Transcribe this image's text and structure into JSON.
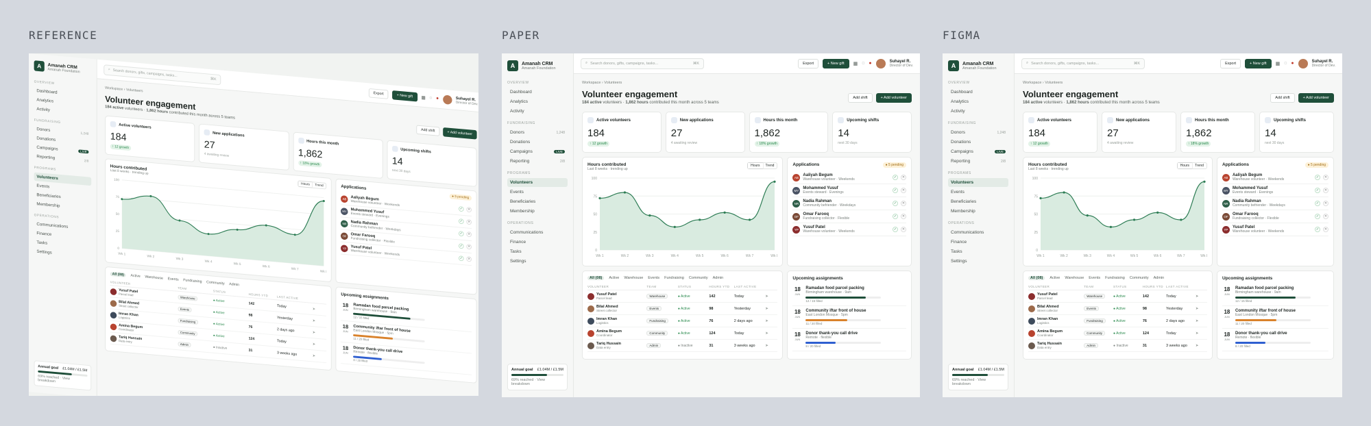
{
  "labels": {
    "reference": "REFERENCE",
    "paper": "PAPER",
    "figma": "FIGMA"
  },
  "org": {
    "name": "Amanah CRM",
    "sub": "Amanah Foundation",
    "mark": "A"
  },
  "nav": {
    "overview_label": "OVERVIEW",
    "overview": [
      "Dashboard",
      "Analytics",
      "Activity"
    ],
    "fundraising_label": "FUNDRAISING",
    "fundraising": [
      {
        "label": "Donors",
        "badge": "1,248"
      },
      {
        "label": "Donations",
        "badge": ""
      },
      {
        "label": "Campaigns",
        "badge": "LIVE"
      },
      {
        "label": "Reporting",
        "badge": "2/8"
      }
    ],
    "programs_label": "PROGRAMS",
    "programs": [
      "Volunteers",
      "Events",
      "Beneficiaries",
      "Membership"
    ],
    "operations_label": "OPERATIONS",
    "operations": [
      "Communications",
      "Finance",
      "Tasks",
      "Settings"
    ]
  },
  "goal": {
    "label": "Annual goal",
    "value": "£1.04M / £1.5M",
    "note": "69% reached · View breakdown",
    "progress": 0.69
  },
  "search": {
    "placeholder": "Search donors, gifts, campaigns, tasks...",
    "kbd": "⌘K"
  },
  "top": {
    "export": "Export",
    "new_gift": "+ New gift",
    "user": "Suhayel R.",
    "role": "Director of Dev."
  },
  "page": {
    "crumb": "Workspace  ›  Volunteers",
    "title": "Volunteer engagement",
    "sub_strong1": "184 active",
    "sub1": " volunteers · ",
    "sub_strong2": "1,862 hours",
    "sub2": " contributed this month across 5 teams",
    "add_shift": "Add shift",
    "add_volunteer": "+ Add volunteer"
  },
  "kpis": [
    {
      "label": "Active volunteers",
      "value": "184",
      "note": "↑ 12 growth",
      "growth": true
    },
    {
      "label": "New applications",
      "value": "27",
      "note": "4 awaiting review",
      "growth": false
    },
    {
      "label": "Hours this month",
      "value": "1,862",
      "note": "↑ 18% growth",
      "growth": true
    },
    {
      "label": "Upcoming shifts",
      "value": "14",
      "note": "next 30 days",
      "growth": false
    }
  ],
  "chart_title": "Hours contributed",
  "chart_sub": "Last 8 weeks · trending up",
  "seg": [
    "Hours",
    "Trend"
  ],
  "chart_data": {
    "type": "area",
    "x": [
      "Wk 1",
      "Wk 2",
      "Wk 3",
      "Wk 4",
      "Wk 5",
      "Wk 6",
      "Wk 7",
      "Wk 8"
    ],
    "values": [
      72,
      80,
      48,
      32,
      42,
      52,
      42,
      95
    ],
    "yticks": [
      0,
      25,
      50,
      75,
      100
    ],
    "ylim": [
      0,
      100
    ]
  },
  "applications": {
    "title": "Applications",
    "pending": "● 5 pending",
    "items": [
      {
        "initials": "AB",
        "name": "Aaliyah Begum",
        "desc": "Warehouse volunteer · Weekends",
        "color": "#b8432f"
      },
      {
        "initials": "MY",
        "name": "Mohammed Yusuf",
        "desc": "Events steward · Evenings",
        "color": "#4a5364"
      },
      {
        "initials": "NR",
        "name": "Nadia Rahman",
        "desc": "Community befriender · Weekdays",
        "color": "#2e5e48"
      },
      {
        "initials": "OF",
        "name": "Omar Farooq",
        "desc": "Fundraising collector · Flexible",
        "color": "#7a4a36"
      },
      {
        "initials": "YP",
        "name": "Yusuf Patel",
        "desc": "Warehouse volunteer · Weekends",
        "color": "#8b2d2d"
      }
    ]
  },
  "filters": [
    "All (08)",
    "Active",
    "Warehouse",
    "Events",
    "Fundraising",
    "Community",
    "Admin"
  ],
  "table_head": [
    "VOLUNTEER",
    "TEAM",
    "STATUS",
    "HOURS YTD",
    "LAST ACTIVE",
    ""
  ],
  "rows": [
    {
      "name": "Yusuf Patel",
      "role": "Parcel lead",
      "team": "Warehouse",
      "status": "● Active",
      "hours": "142",
      "last": "Today",
      "color": "#8b2d2d"
    },
    {
      "name": "Bilal Ahmed",
      "role": "Street collector",
      "team": "Events",
      "status": "● Active",
      "hours": "98",
      "last": "Yesterday",
      "color": "#9c6a4a"
    },
    {
      "name": "Imran Khan",
      "role": "Logistics",
      "team": "Fundraising",
      "status": "● Active",
      "hours": "76",
      "last": "2 days ago",
      "color": "#3e4b5c"
    },
    {
      "name": "Amina Begum",
      "role": "Coordinator",
      "team": "Community",
      "status": "● Active",
      "hours": "124",
      "last": "Today",
      "color": "#b8432f"
    },
    {
      "name": "Tariq Hussain",
      "role": "Data entry",
      "team": "Admin",
      "status": "● Inactive",
      "hours": "31",
      "last": "3 weeks ago",
      "color": "#6b5a4e"
    }
  ],
  "assign": {
    "title": "Upcoming assignments",
    "items": [
      {
        "day": "18",
        "mon": "JUN",
        "name": "Ramadan food parcel packing",
        "place": "Birmingham warehouse · 9am",
        "filled": "12 / 15 filled",
        "pct": 0.8,
        "color": "#1f4f3a"
      },
      {
        "day": "18",
        "mon": "JUN",
        "name": "Community iftar front of house",
        "place": "East London Mosque · 5pm",
        "filled": "11 / 20 filled",
        "pct": 0.55,
        "color": "#d9822b"
      },
      {
        "day": "18",
        "mon": "JUN",
        "name": "Donor thank-you call drive",
        "place": "Remote · flexible",
        "filled": "8 / 20 filled",
        "pct": 0.4,
        "color": "#2f5fd0"
      }
    ]
  },
  "colors": {
    "accent": "#1f4f3a",
    "growth": "#2b8a4e"
  }
}
